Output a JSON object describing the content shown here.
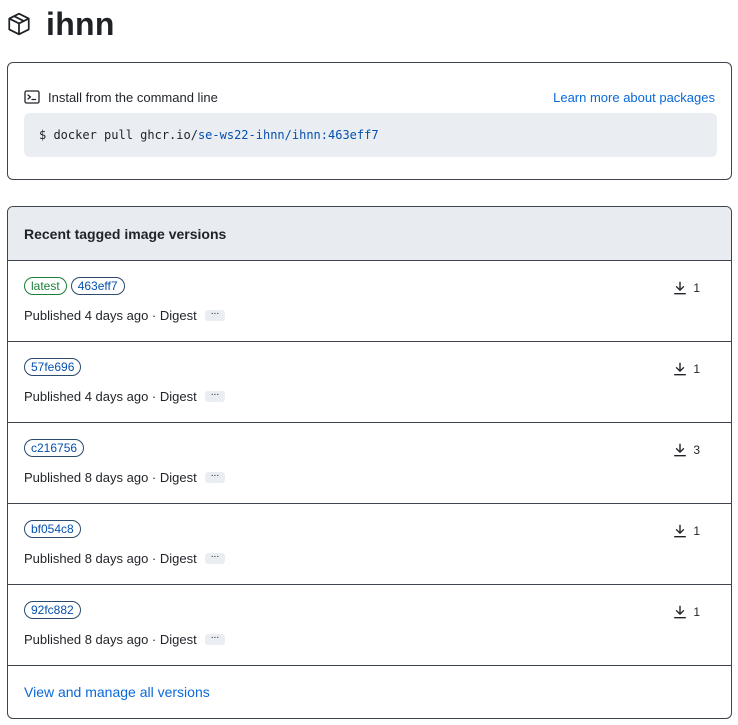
{
  "package": {
    "name": "ihnn",
    "icon": "package-icon"
  },
  "install": {
    "label": "Install from the command line",
    "learn_more": "Learn more about packages",
    "command_prefix": "$ docker pull ghcr.io/",
    "command_path": "se-ws22-ihnn/ihnn:463eff7"
  },
  "versions": {
    "title": "Recent tagged image versions",
    "view_all": "View and manage all versions",
    "rows": [
      {
        "tags": [
          "latest",
          "463eff7"
        ],
        "published": "Published 4 days ago · Digest",
        "downloads": "1"
      },
      {
        "tags": [
          "57fe696"
        ],
        "published": "Published 4 days ago · Digest",
        "downloads": "1"
      },
      {
        "tags": [
          "c216756"
        ],
        "published": "Published 8 days ago · Digest",
        "downloads": "3"
      },
      {
        "tags": [
          "bf054c8"
        ],
        "published": "Published 8 days ago · Digest",
        "downloads": "1"
      },
      {
        "tags": [
          "92fc882"
        ],
        "published": "Published 8 days ago · Digest",
        "downloads": "1"
      }
    ]
  },
  "colors": {
    "link": "#0969da",
    "latest_tag": "#1a7f37",
    "code_bg": "#eaeef2",
    "header_bg": "#e8ecf0"
  }
}
